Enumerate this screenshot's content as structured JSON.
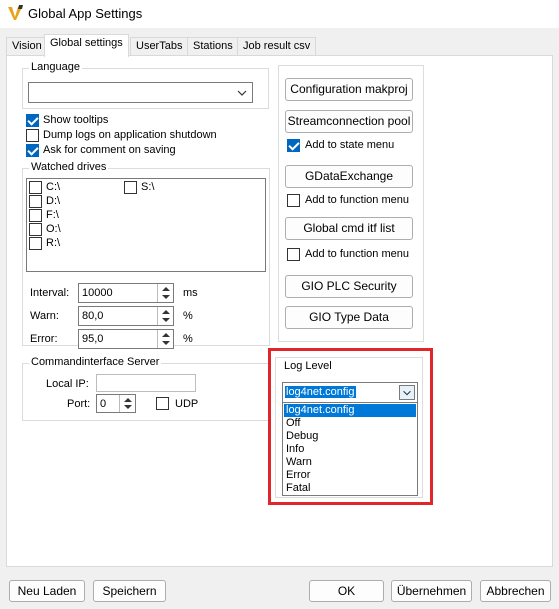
{
  "window": {
    "title": "Global App Settings"
  },
  "tabs": [
    {
      "label": "Vision"
    },
    {
      "label": "Global settings"
    },
    {
      "label": "UserTabs"
    },
    {
      "label": "Stations"
    },
    {
      "label": "Job result csv"
    }
  ],
  "language": {
    "group_label": "Language",
    "value": ""
  },
  "checkboxes": {
    "show_tooltips": {
      "label": "Show tooltips",
      "checked": true
    },
    "dump_logs": {
      "label": "Dump logs on application shutdown",
      "checked": false
    },
    "ask_comment": {
      "label": "Ask for comment on saving",
      "checked": true
    }
  },
  "watched_drives": {
    "group_label": "Watched drives",
    "drives": [
      "C:\\",
      "D:\\",
      "F:\\",
      "O:\\",
      "R:\\",
      "S:\\"
    ]
  },
  "interval": {
    "label": "Interval:",
    "value": "10000",
    "unit": "ms"
  },
  "warn": {
    "label": "Warn:",
    "value": "80,0",
    "unit": "%"
  },
  "error": {
    "label": "Error:",
    "value": "95,0",
    "unit": "%"
  },
  "command_interface": {
    "group_label": "Commandinterface Server",
    "local_ip_label": "Local IP:",
    "local_ip_value": "",
    "port_label": "Port:",
    "port_value": "0",
    "udp_label": "UDP"
  },
  "right_panel": {
    "config_makproj": "Configuration makproj",
    "streamconnection_pool": "Streamconnection pool",
    "add_to_state_menu": "Add to state menu",
    "gdataexchange": "GDataExchange",
    "add_to_function_menu_1": "Add to function menu",
    "global_cmd_itf_list": "Global cmd itf list",
    "add_to_function_menu_2": "Add to function menu",
    "gio_plc_security": "GIO PLC Security",
    "gio_type_data": "GIO Type Data"
  },
  "log_level": {
    "group_label": "Log Level",
    "selected": "log4net.config",
    "options": [
      "log4net.config",
      "Off",
      "Debug",
      "Info",
      "Warn",
      "Error",
      "Fatal"
    ]
  },
  "footer": {
    "neu_laden": "Neu Laden",
    "speichern": "Speichern",
    "ok": "OK",
    "uebernehmen": "Übernehmen",
    "abbrechen": "Abbrechen"
  },
  "colors": {
    "accent": "#0067c0",
    "selection": "#0078d7",
    "highlight_box": "#e1262b"
  }
}
